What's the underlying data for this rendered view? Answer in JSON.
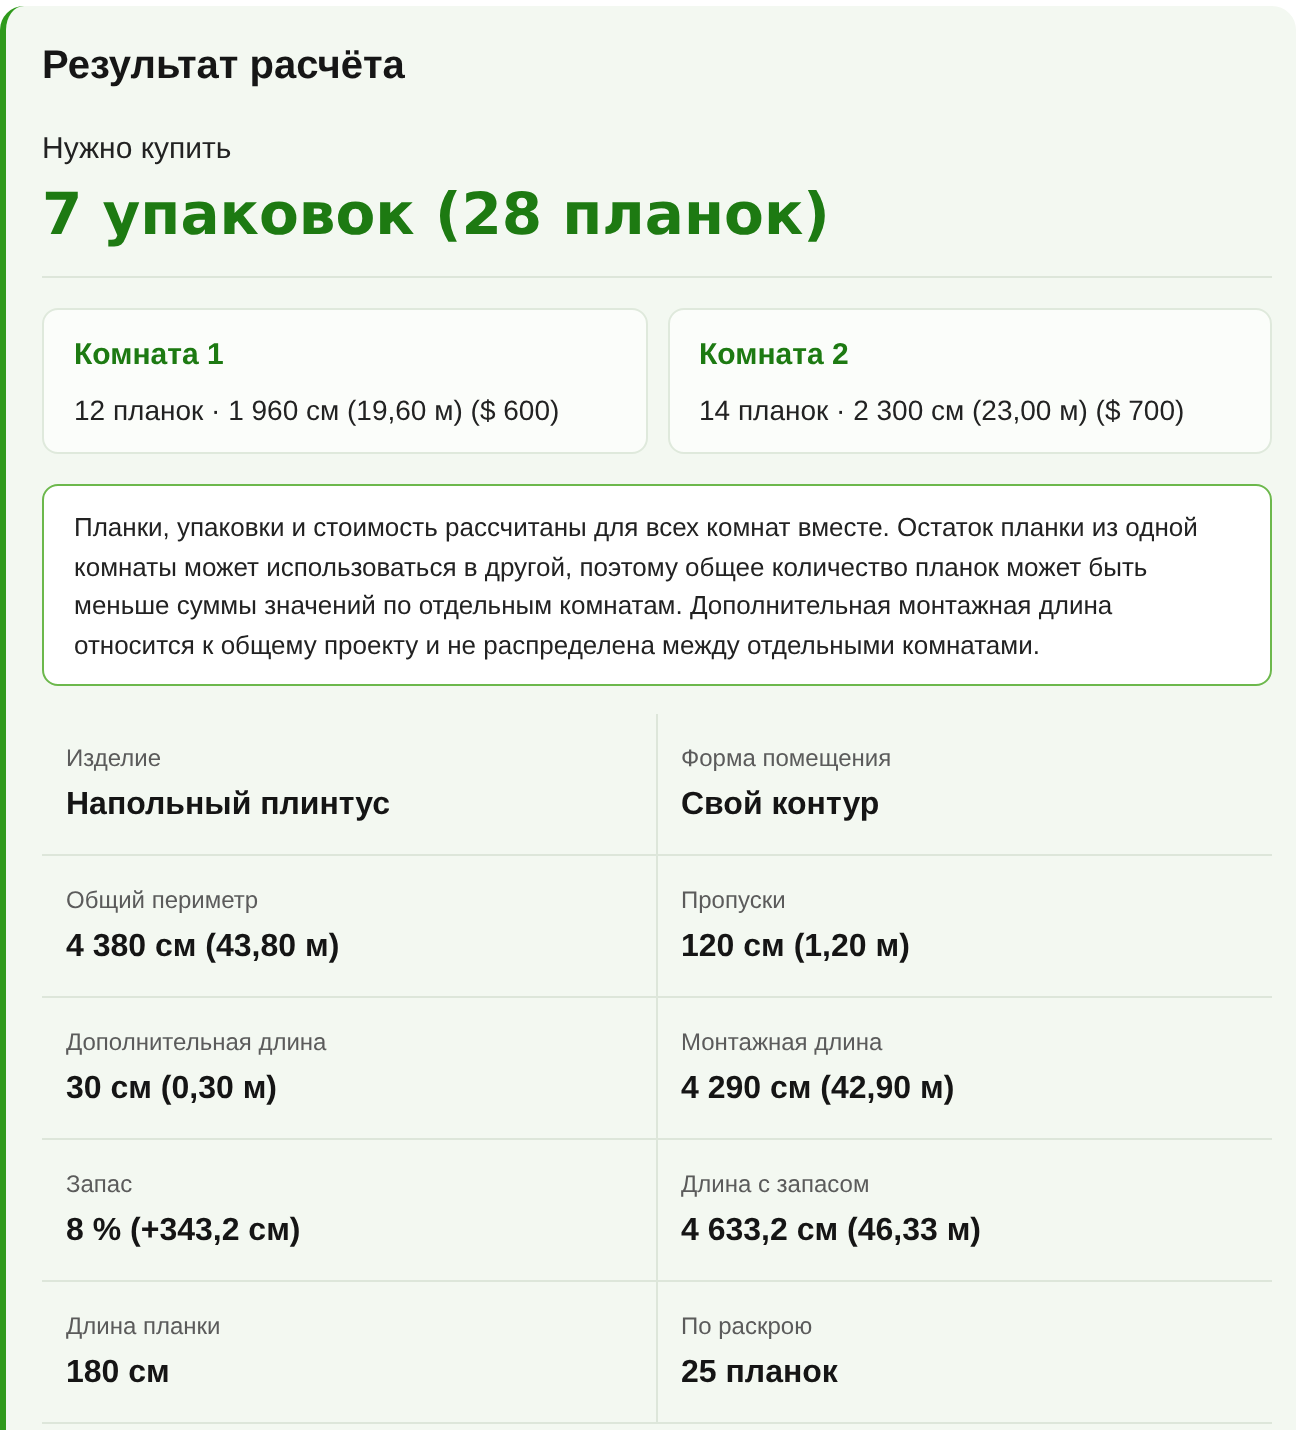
{
  "result": {
    "title": "Результат расчёта",
    "buy_label": "Нужно купить",
    "buy_value": "7 упаковок (28 планок)"
  },
  "rooms": [
    {
      "name": "Комната 1",
      "details": "12 планок · 1 960 см (19,60 м) ($ 600)"
    },
    {
      "name": "Комната 2",
      "details": "14 планок · 2 300 см (23,00 м) ($ 700)"
    }
  ],
  "note": "Планки, упаковки и стоимость рассчитаны для всех комнат вместе. Остаток планки из одной комнаты может использоваться в другой, поэтому общее количество планок может быть меньше суммы значений по отдельным комнатам. Дополнительная монтажная длина относится к общему проекту и не распределена между отдельными комнатами.",
  "details": [
    {
      "label": "Изделие",
      "value": "Напольный плинтус"
    },
    {
      "label": "Форма помещения",
      "value": "Свой контур"
    },
    {
      "label": "Общий периметр",
      "value": "4 380 см (43,80 м)"
    },
    {
      "label": "Пропуски",
      "value": "120 см (1,20 м)"
    },
    {
      "label": "Дополнительная длина",
      "value": "30 см (0,30 м)"
    },
    {
      "label": "Монтажная длина",
      "value": "4 290 см (42,90 м)"
    },
    {
      "label": "Запас",
      "value": "8 % (+343,2 см)"
    },
    {
      "label": "Длина с запасом",
      "value": "4 633,2 см (46,33 м)"
    },
    {
      "label": "Длина планки",
      "value": "180 см"
    },
    {
      "label": "По раскрою",
      "value": "25 планок"
    }
  ]
}
